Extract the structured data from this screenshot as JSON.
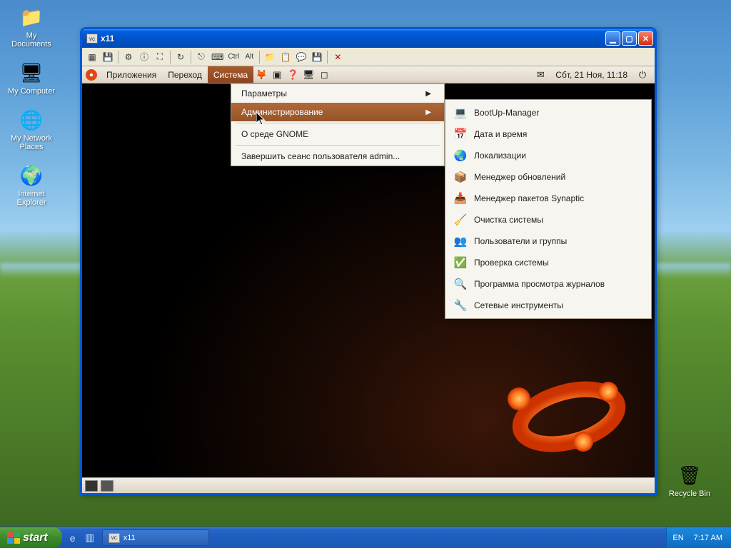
{
  "xp": {
    "desktop_icons": [
      {
        "label": "My Documents",
        "glyph": "📁"
      },
      {
        "label": "My Computer",
        "glyph": "🖥"
      },
      {
        "label": "My Network Places",
        "glyph": "🌐"
      },
      {
        "label": "Internet Explorer",
        "glyph": "🌍"
      }
    ],
    "recycle_bin": "Recycle Bin",
    "taskbar": {
      "start": "start",
      "task_items": [
        "x11"
      ],
      "lang": "EN",
      "time": "7:17 AM"
    }
  },
  "vnc": {
    "title": "x11",
    "toolbar_keys": {
      "ctrl": "Ctrl",
      "alt": "Alt"
    }
  },
  "gnome": {
    "menus": {
      "applications": "Приложения",
      "places": "Переход",
      "system": "Система"
    },
    "clock": "Сбт, 21 Ноя, 11:18",
    "system_menu": {
      "params": "Параметры",
      "admin": "Администрирование",
      "about": "О среде GNOME",
      "logout": "Завершить сеанс пользователя admin..."
    },
    "admin_items": [
      {
        "icon": "💻",
        "label": "BootUp-Manager"
      },
      {
        "icon": "📅",
        "label": "Дата и время"
      },
      {
        "icon": "🌏",
        "label": "Локализации"
      },
      {
        "icon": "📦",
        "label": "Менеджер обновлений"
      },
      {
        "icon": "📥",
        "label": "Менеджер пакетов Synaptic"
      },
      {
        "icon": "🧹",
        "label": "Очистка системы"
      },
      {
        "icon": "👥",
        "label": "Пользователи и группы"
      },
      {
        "icon": "✅",
        "label": "Проверка системы"
      },
      {
        "icon": "🔍",
        "label": "Программа просмотра журналов"
      },
      {
        "icon": "🔧",
        "label": "Сетевые инструменты"
      }
    ]
  }
}
